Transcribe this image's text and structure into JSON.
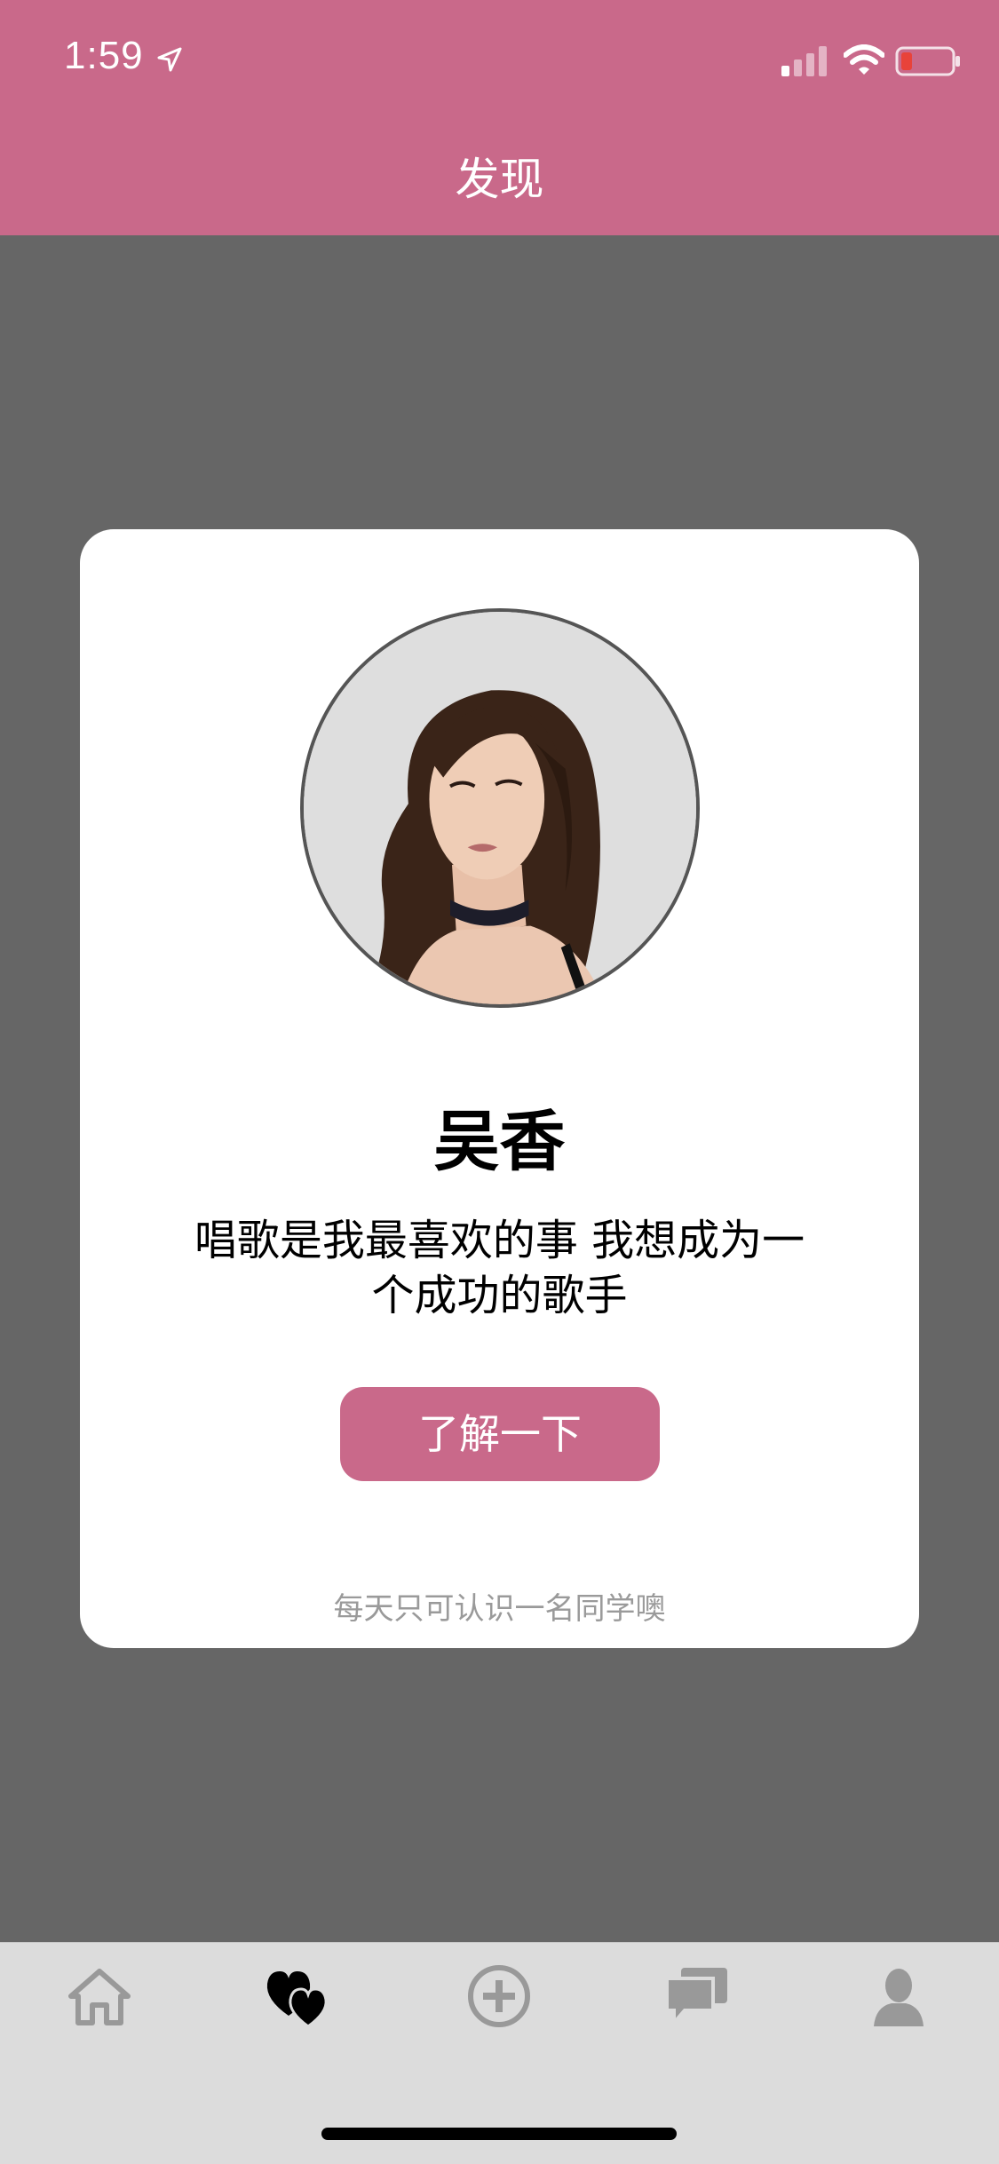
{
  "status_bar": {
    "time": "1:59",
    "battery_color": "#e8433a"
  },
  "header": {
    "title": "发现",
    "background": "#c9698a"
  },
  "card": {
    "name": "吴香",
    "bio_line1": "唱歌是我最喜欢的事 我想成为一",
    "bio_line2": "个成功的歌手",
    "button_label": "了解一下",
    "footer_note": "每天只可认识一名同学噢"
  },
  "tab_bar": {
    "items": [
      {
        "icon": "home-icon",
        "active": false
      },
      {
        "icon": "hearts-icon",
        "active": true
      },
      {
        "icon": "plus-circle-icon",
        "active": false
      },
      {
        "icon": "chat-bubbles-icon",
        "active": false
      },
      {
        "icon": "person-icon",
        "active": false
      }
    ],
    "active_color": "#000000",
    "inactive_color": "#999999"
  }
}
